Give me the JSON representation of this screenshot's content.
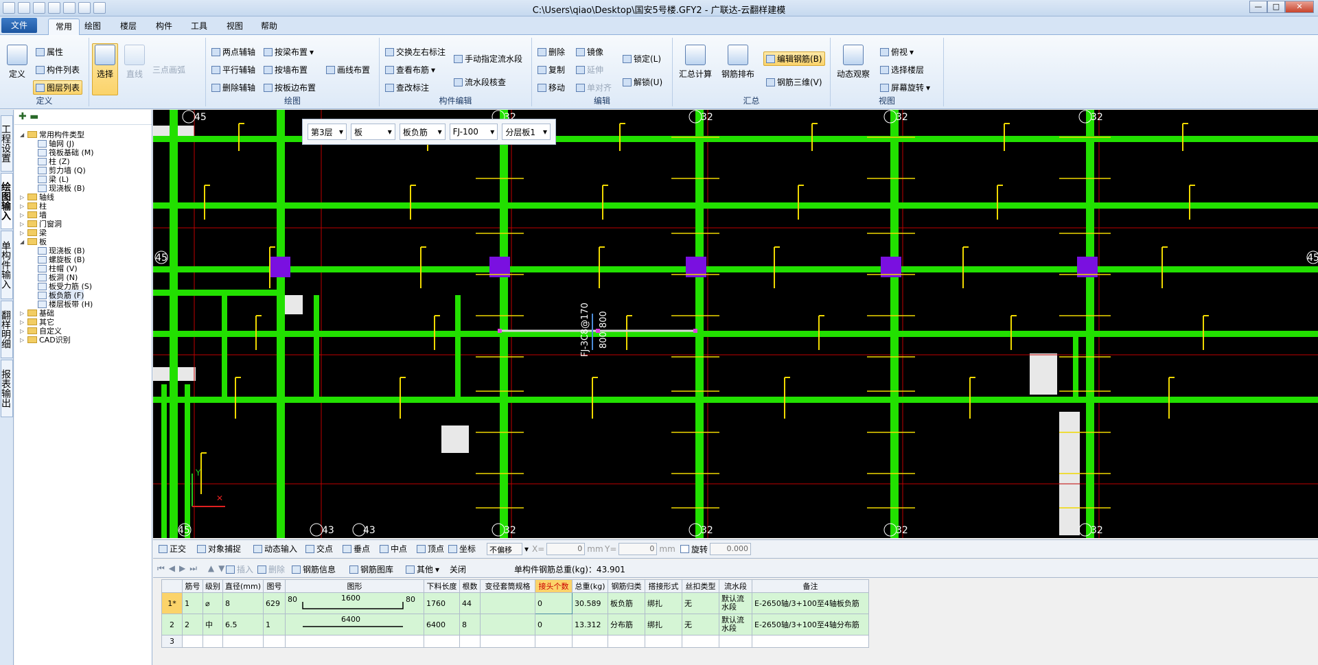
{
  "window": {
    "title": "C:\\Users\\qiao\\Desktop\\国安5号楼.GFY2 - 广联达-云翻样建模",
    "buttons": [
      "—",
      "□",
      "✕"
    ]
  },
  "menu": {
    "file": "文件",
    "tabs": [
      "常用",
      "绘图",
      "楼层",
      "构件",
      "工具",
      "视图",
      "帮助"
    ]
  },
  "ribbon": {
    "define": {
      "label": "定义",
      "big": "定义",
      "items": [
        "属性",
        "构件列表",
        "图层列表"
      ]
    },
    "select": {
      "big": "选择",
      "line": "直线",
      "arc": "三点画弧"
    },
    "draw": {
      "label": "绘图",
      "items": [
        "两点辅轴",
        "按梁布置",
        "平行辅轴",
        "按墙布置",
        "画线布置",
        "删除辅轴",
        "按板边布置"
      ]
    },
    "edit_comp": {
      "label": "构件编辑",
      "items": [
        "交换左右标注",
        "手动指定流水段",
        "查看布筋",
        "流水段核查",
        "查改标注"
      ]
    },
    "edit": {
      "label": "编辑",
      "items": [
        "删除",
        "镜像",
        "复制",
        "延伸",
        "移动",
        "单对齐",
        "锁定(L)",
        "解锁(U)"
      ]
    },
    "summary": {
      "label": "汇总",
      "items": [
        "汇总计算",
        "钢筋排布",
        "编辑钢筋(B)",
        "钢筋三维(V)"
      ]
    },
    "view": {
      "label": "视图",
      "items": [
        "动态观察",
        "俯视",
        "选择楼层",
        "屏幕旋转"
      ]
    }
  },
  "vtabs": [
    "工程设置",
    "绘图输入",
    "单构件输入",
    "翻样明细",
    "报表输出"
  ],
  "tree": {
    "toolbar": "✚ ▬",
    "nodes": [
      {
        "label": "常用构件类型",
        "lvl": 1,
        "type": "folder",
        "ex": "◢"
      },
      {
        "label": "轴网 (J)",
        "lvl": 2,
        "type": "item"
      },
      {
        "label": "筏板基础 (M)",
        "lvl": 2,
        "type": "item"
      },
      {
        "label": "柱 (Z)",
        "lvl": 2,
        "type": "item"
      },
      {
        "label": "剪力墙 (Q)",
        "lvl": 2,
        "type": "item"
      },
      {
        "label": "梁 (L)",
        "lvl": 2,
        "type": "item"
      },
      {
        "label": "现浇板 (B)",
        "lvl": 2,
        "type": "item"
      },
      {
        "label": "轴线",
        "lvl": 1,
        "type": "folder",
        "ex": "▷"
      },
      {
        "label": "柱",
        "lvl": 1,
        "type": "folder",
        "ex": "▷"
      },
      {
        "label": "墙",
        "lvl": 1,
        "type": "folder",
        "ex": "▷"
      },
      {
        "label": "门窗洞",
        "lvl": 1,
        "type": "folder",
        "ex": "▷"
      },
      {
        "label": "梁",
        "lvl": 1,
        "type": "folder",
        "ex": "▷"
      },
      {
        "label": "板",
        "lvl": 1,
        "type": "folder",
        "ex": "◢"
      },
      {
        "label": "现浇板 (B)",
        "lvl": 2,
        "type": "item"
      },
      {
        "label": "螺旋板 (B)",
        "lvl": 2,
        "type": "item"
      },
      {
        "label": "柱帽 (V)",
        "lvl": 2,
        "type": "item"
      },
      {
        "label": "板洞 (N)",
        "lvl": 2,
        "type": "item"
      },
      {
        "label": "板受力筋 (S)",
        "lvl": 2,
        "type": "item"
      },
      {
        "label": "板负筋 (F)",
        "lvl": 2,
        "type": "item",
        "sel": true
      },
      {
        "label": "楼层板带 (H)",
        "lvl": 2,
        "type": "item"
      },
      {
        "label": "基础",
        "lvl": 1,
        "type": "folder",
        "ex": "▷"
      },
      {
        "label": "其它",
        "lvl": 1,
        "type": "folder",
        "ex": "▷"
      },
      {
        "label": "自定义",
        "lvl": 1,
        "type": "folder",
        "ex": "▷"
      },
      {
        "label": "CAD识别",
        "lvl": 1,
        "type": "folder",
        "ex": "▷"
      }
    ]
  },
  "floatbar": {
    "floor": "第3层",
    "type": "板",
    "sub": "板负筋",
    "name": "FJ-100",
    "layer": "分层板1"
  },
  "canvas": {
    "axis_labels_top": [
      "45",
      "32",
      "32",
      "32",
      "32"
    ],
    "axis_labels_bottom": [
      "45",
      "43",
      "43",
      "32",
      "32",
      "32",
      "32"
    ],
    "axis_labels_side": [
      "45",
      "45"
    ],
    "annotation": "FJ-3C8@170",
    "dim1": "800",
    "dim2": "800",
    "ucs_y": "Y",
    "ucs_x": "✕"
  },
  "snapbar": {
    "items": [
      "正交",
      "对象捕捉",
      "动态输入",
      "交点",
      "垂点",
      "中点",
      "顶点",
      "坐标"
    ],
    "mode": "不偏移",
    "x_label": "X=",
    "x_val": "0",
    "unit": "mm",
    "y_label": "Y=",
    "y_val": "0",
    "rotate": "旋转",
    "rot_val": "0.000"
  },
  "rebarbar": {
    "items": [
      "插入",
      "删除",
      "钢筋信息",
      "钢筋图库",
      "其他",
      "关闭"
    ],
    "total": "单构件钢筋总重(kg)：43.901"
  },
  "grid": {
    "headers": [
      "筋号",
      "级别",
      "直径(mm)",
      "图号",
      "图形",
      "下料长度",
      "根数",
      "变径套筒规格",
      "接头个数",
      "总重(kg)",
      "钢筋归类",
      "搭接形式",
      "丝扣类型",
      "流水段",
      "备注"
    ],
    "rows": [
      {
        "rn": "1*",
        "no": "1",
        "grade": "⌀",
        "dia": "8",
        "fig": "629",
        "s_left": "80",
        "s_mid": "1600",
        "s_right": "80",
        "len": "1760",
        "count": "44",
        "sleeve": "",
        "joints": "0",
        "weight": "30.589",
        "cat": "板负筋",
        "lap": "绑扎",
        "thread": "无",
        "seg": "默认流水段",
        "note": "E-2650轴/3+100至4轴板负筋"
      },
      {
        "rn": "2",
        "no": "2",
        "grade": "中",
        "dia": "6.5",
        "fig": "1",
        "s_left": "",
        "s_mid": "6400",
        "s_right": "",
        "len": "6400",
        "count": "8",
        "sleeve": "",
        "joints": "0",
        "weight": "13.312",
        "cat": "分布筋",
        "lap": "绑扎",
        "thread": "无",
        "seg": "默认流水段",
        "note": "E-2650轴/3+100至4轴分布筋"
      },
      {
        "rn": "3"
      }
    ]
  },
  "colors": {
    "beam": "#22e000",
    "rebar": "#f0d800",
    "column": "#7a10e0",
    "axis": "#c00000",
    "bg": "#000000"
  }
}
